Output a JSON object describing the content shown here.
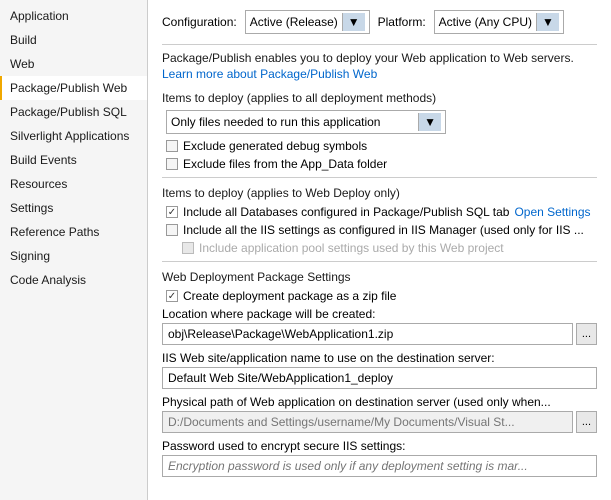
{
  "sidebar": {
    "items": [
      {
        "label": "Application",
        "active": false
      },
      {
        "label": "Build",
        "active": false
      },
      {
        "label": "Web",
        "active": false
      },
      {
        "label": "Package/Publish Web",
        "active": true
      },
      {
        "label": "Package/Publish SQL",
        "active": false
      },
      {
        "label": "Silverlight Applications",
        "active": false
      },
      {
        "label": "Build Events",
        "active": false
      },
      {
        "label": "Resources",
        "active": false
      },
      {
        "label": "Settings",
        "active": false
      },
      {
        "label": "Reference Paths",
        "active": false
      },
      {
        "label": "Signing",
        "active": false
      },
      {
        "label": "Code Analysis",
        "active": false
      }
    ]
  },
  "header": {
    "configuration_label": "Configuration:",
    "configuration_value": "Active (Release)",
    "platform_label": "Platform:",
    "platform_value": "Active (Any CPU)"
  },
  "description": {
    "text": "Package/Publish enables you to deploy your Web application to Web servers.",
    "link_text": "Learn more about Package/Publish Web"
  },
  "deploy_all": {
    "section_label": "Items to deploy (applies to all deployment methods)",
    "dropdown_value": "Only files needed to run this application",
    "checkbox1_label": "Exclude generated debug symbols",
    "checkbox1_checked": false,
    "checkbox2_label": "Exclude files from the App_Data folder",
    "checkbox2_checked": false
  },
  "deploy_web": {
    "section_label": "Items to deploy (applies to Web Deploy only)",
    "include_db_label": "Include all Databases configured in Package/Publish SQL tab",
    "include_db_checked": true,
    "open_settings_label": "Open Settings",
    "include_iis_label": "Include all the IIS settings as configured in IIS Manager (used only for IIS ...",
    "include_iis_checked": false,
    "include_pool_label": "Include application pool settings used by this Web project",
    "include_pool_checked": false,
    "include_pool_disabled": true
  },
  "web_deployment": {
    "section_label": "Web Deployment Package Settings",
    "create_zip_label": "Create deployment package as a zip file",
    "create_zip_checked": true,
    "location_label": "Location where package will be created:",
    "location_value": "obj\\Release\\Package\\WebApplication1.zip",
    "iis_label": "IIS Web site/application name to use on the destination server:",
    "iis_value": "Default Web Site/WebApplication1_deploy",
    "physical_label": "Physical path of Web application on destination server (used only when...",
    "physical_placeholder": "D:/Documents and Settings/username/My Documents/Visual St...",
    "password_label": "Password used to encrypt secure IIS settings:",
    "password_placeholder": "Encryption password is used only if any deployment setting is mar..."
  },
  "browse_button_label": "..."
}
